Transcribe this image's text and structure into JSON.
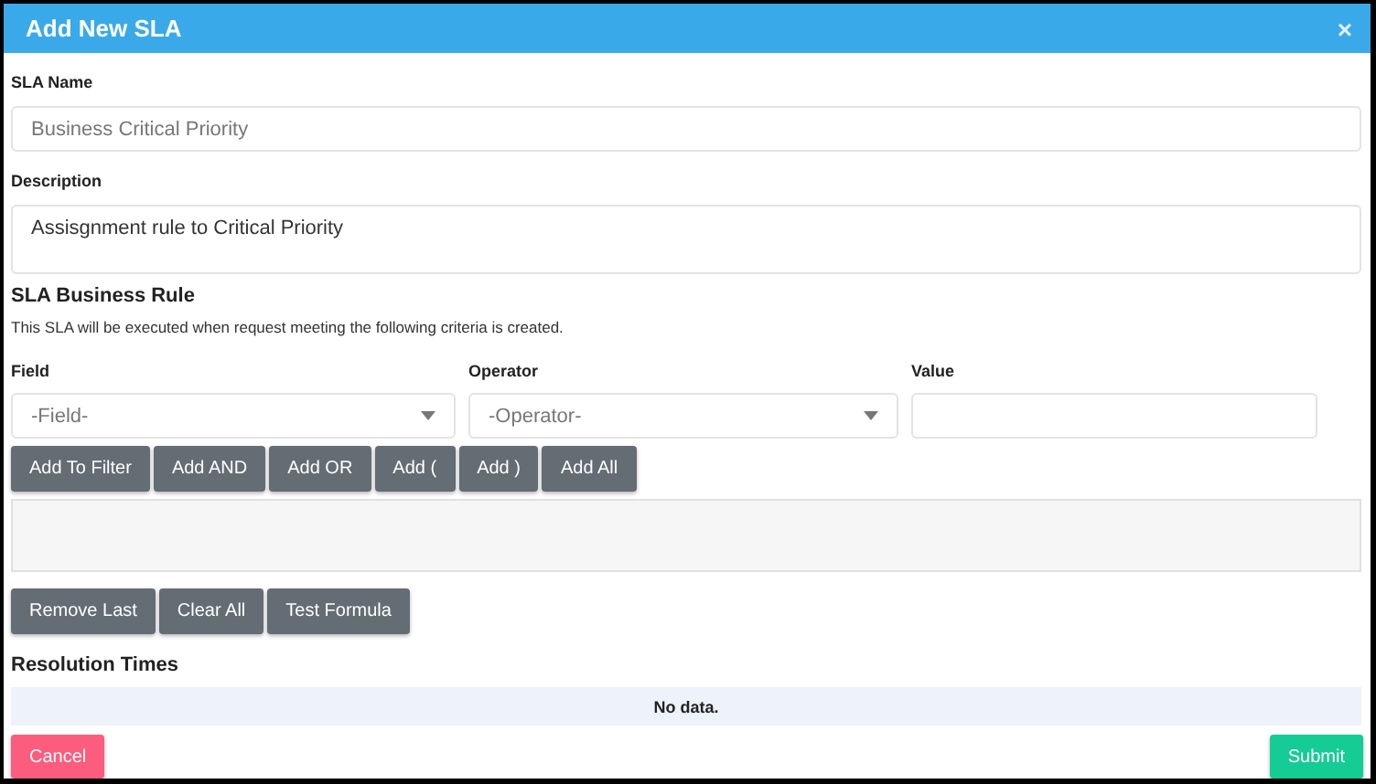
{
  "dialog": {
    "title": "Add New SLA",
    "close": "×"
  },
  "sla_name": {
    "label": "SLA Name",
    "placeholder": "Business Critical Priority"
  },
  "description": {
    "label": "Description",
    "value": "Assisgnment rule to Critical Priority"
  },
  "business_rule": {
    "heading": "SLA Business Rule",
    "note": "This SLA will be executed when request meeting the following criteria is created.",
    "criteria": [
      {
        "kind": "select",
        "label": "Field",
        "placeholder": "-Field-"
      },
      {
        "kind": "select",
        "label": "Operator",
        "placeholder": "-Operator-"
      },
      {
        "kind": "input",
        "label": "Value"
      }
    ],
    "filter_buttons": [
      "Add To Filter",
      "Add AND",
      "Add OR",
      "Add (",
      "Add )",
      "Add All"
    ],
    "formula_buttons": [
      "Remove Last",
      "Clear All",
      "Test Formula"
    ]
  },
  "resolution_times": {
    "heading": "Resolution Times",
    "empty": "No data."
  },
  "footer": {
    "cancel": "Cancel",
    "submit": "Submit"
  }
}
